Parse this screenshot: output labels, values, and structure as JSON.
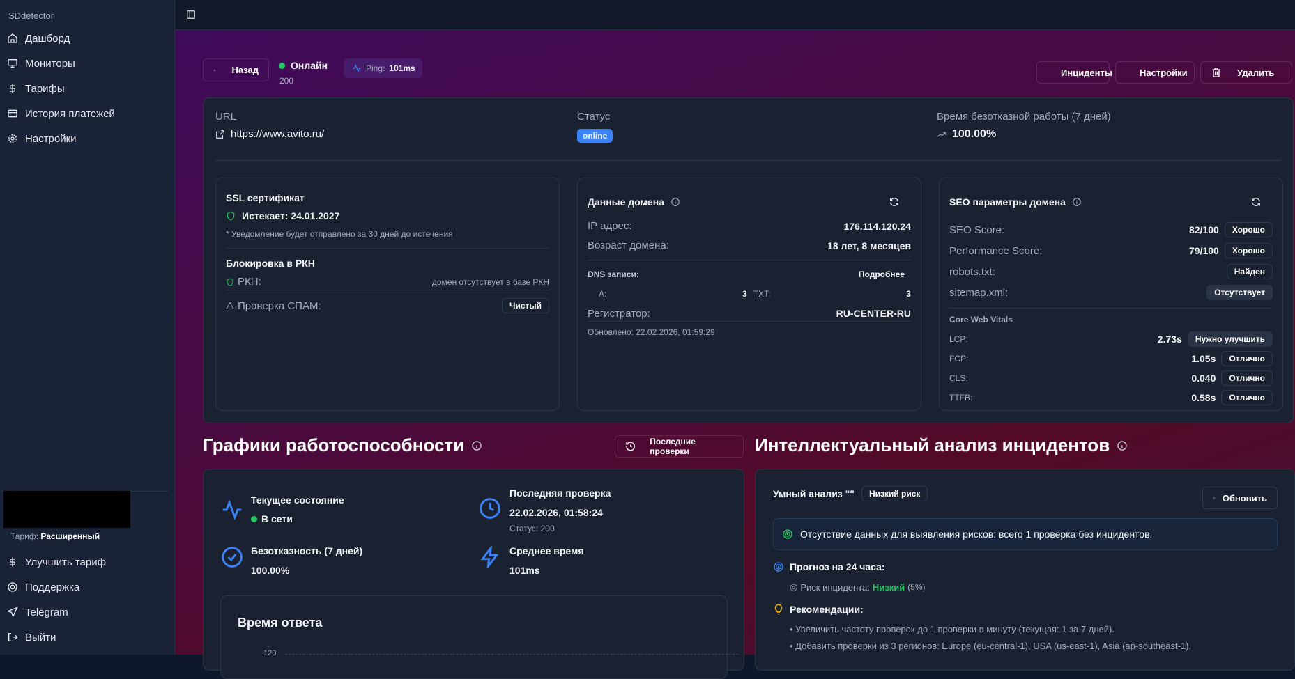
{
  "app": {
    "brand": "SDdetector"
  },
  "sidebar": {
    "items": [
      {
        "label": "Дашборд",
        "icon": "home-icon"
      },
      {
        "label": "Мониторы",
        "icon": "monitor-icon"
      },
      {
        "label": "Тарифы",
        "icon": "dollar-icon"
      },
      {
        "label": "История платежей",
        "icon": "credit-card-icon"
      },
      {
        "label": "Настройки",
        "icon": "gear-icon"
      }
    ],
    "plan_label": "Тариф:",
    "plan_value": "Расширенный",
    "bottom_items": [
      {
        "label": "Улучшить тариф"
      },
      {
        "label": "Поддержка"
      },
      {
        "label": "Telegram"
      },
      {
        "label": "Выйти"
      }
    ]
  },
  "header": {
    "back": "Назад",
    "status": "Онлайн",
    "code": "200",
    "ping_label": "Ping:",
    "ping_value": "101ms",
    "incidents": "Инциденты",
    "settings": "Настройки",
    "delete": "Удалить"
  },
  "summary": {
    "url_label": "URL",
    "url": "https://www.avito.ru/",
    "status_label": "Статус",
    "status": "online",
    "uptime_label": "Время безотказной работы (7 дней)",
    "uptime": "100.00%"
  },
  "ssl": {
    "title": "SSL сертификат",
    "expires": "Истекает: 24.01.2027",
    "note": "* Уведомление будет отправлено за 30 дней до истечения",
    "rkn_title": "Блокировка в РКН",
    "rkn_label": "РКН:",
    "rkn_value": "домен отсутствует в базе РКН",
    "spam_label": "Проверка СПАМ:",
    "spam_value": "Чистый"
  },
  "domain": {
    "title": "Данные домена",
    "ip_label": "IP адрес:",
    "ip": "176.114.120.24",
    "age_label": "Возраст домена:",
    "age": "18 лет, 8 месяцев",
    "dns_label": "DNS записи:",
    "dns_more": "Подробнее",
    "a_label": "A:",
    "a": "3",
    "txt_label": "TXT:",
    "txt": "3",
    "registrar_label": "Регистратор:",
    "registrar": "RU-CENTER-RU",
    "updated": "Обновлено: 22.02.2026, 01:59:29"
  },
  "seo": {
    "title": "SEO параметры домена",
    "rows": [
      {
        "label": "SEO Score:",
        "value": "82/100",
        "badge": "Хорошо"
      },
      {
        "label": "Performance Score:",
        "value": "79/100",
        "badge": "Хорошо"
      },
      {
        "label": "robots.txt:",
        "value": "",
        "badge": "Найден"
      },
      {
        "label": "sitemap.xml:",
        "value": "",
        "badge": "Отсутствует"
      }
    ],
    "cwv_title": "Core Web Vitals",
    "cwv": [
      {
        "label": "LCP:",
        "value": "2.73s",
        "badge": "Нужно улучшить"
      },
      {
        "label": "FCP:",
        "value": "1.05s",
        "badge": "Отлично"
      },
      {
        "label": "CLS:",
        "value": "0.040",
        "badge": "Отлично"
      },
      {
        "label": "TTFB:",
        "value": "0.58s",
        "badge": "Отлично"
      }
    ]
  },
  "charts": {
    "title": "Графики работоспособности",
    "recent_btn": "Последние проверки",
    "current_label": "Текущее состояние",
    "current_value": "В сети",
    "last_label": "Последняя проверка",
    "last_value": "22.02.2026, 01:58:24",
    "last_status": "Статус: 200",
    "uptime_label": "Безотказность (7 дней)",
    "uptime_value": "100.00%",
    "avg_label": "Среднее время",
    "avg_value": "101ms",
    "response_title": "Время ответа",
    "y_tick_top": "120"
  },
  "analysis": {
    "title": "Интеллектуальный анализ инцидентов",
    "smart": "Умный анализ \"\"",
    "risk_badge": "Низкий риск",
    "refresh": "Обновить",
    "alert": "Отсутствие данных для выявления рисков: всего 1 проверка без инцидентов.",
    "forecast_title": "Прогноз на 24 часа:",
    "risk_label": "Риск инцидента:",
    "risk_value": "Низкий",
    "risk_pct": "(5%)",
    "rec_title": "Рекомендации:",
    "recs": [
      "Увеличить частоту проверок до 1 проверки в минуту (текущая: 1 за 7 дней).",
      "Добавить проверки из 3 регионов: Europe (eu-central-1), USA (us-east-1), Asia (ap-southeast-1)."
    ]
  },
  "colors": {
    "accent": "#3b82f6",
    "success": "#22c55e",
    "warning": "#eab308"
  }
}
